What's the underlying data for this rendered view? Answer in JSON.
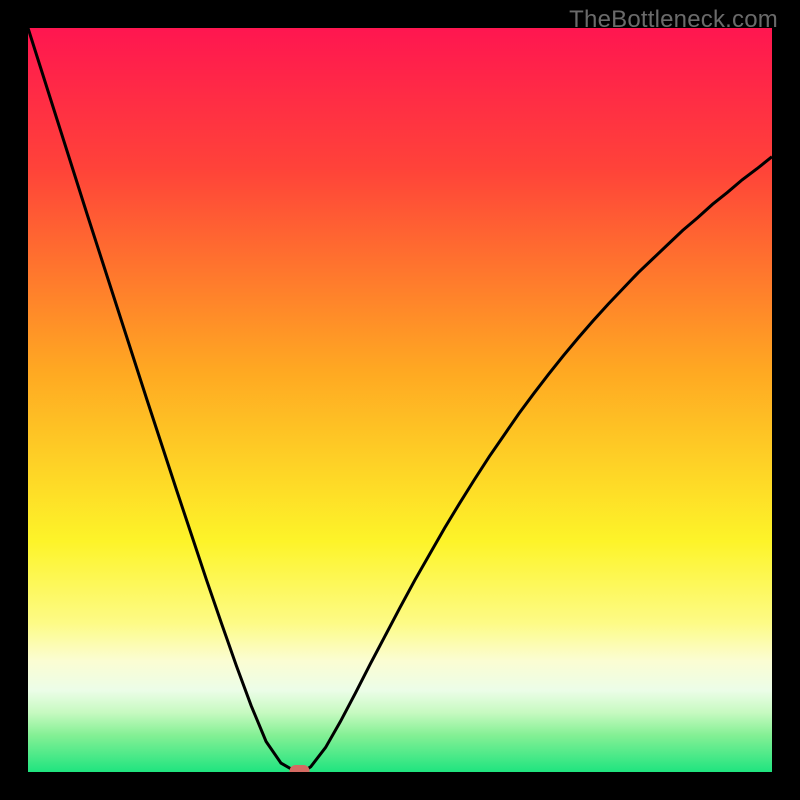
{
  "watermark": "TheBottleneck.com",
  "chart_data": {
    "type": "line",
    "title": "",
    "xlabel": "",
    "ylabel": "",
    "xlim": [
      0,
      100
    ],
    "ylim": [
      0,
      100
    ],
    "x": [
      0,
      2,
      4,
      6,
      8,
      10,
      12,
      14,
      16,
      18,
      20,
      22,
      24,
      26,
      28,
      30,
      32,
      34,
      36,
      36.5,
      37,
      38,
      40,
      42,
      44,
      46,
      48,
      50,
      52,
      54,
      56,
      58,
      60,
      62,
      64,
      66,
      68,
      70,
      72,
      74,
      76,
      78,
      80,
      82,
      84,
      86,
      88,
      90,
      92,
      94,
      96,
      98,
      100
    ],
    "y": [
      100,
      93.7,
      87.4,
      81.1,
      74.8,
      68.6,
      62.4,
      56.2,
      50.0,
      43.9,
      37.8,
      31.8,
      25.8,
      20.0,
      14.3,
      8.9,
      4.1,
      1.2,
      0.05,
      0,
      0.05,
      0.7,
      3.3,
      6.8,
      10.6,
      14.5,
      18.3,
      22.1,
      25.8,
      29.3,
      32.8,
      36.1,
      39.3,
      42.4,
      45.3,
      48.2,
      50.9,
      53.5,
      56.0,
      58.4,
      60.7,
      62.9,
      65.0,
      67.1,
      69.0,
      70.9,
      72.8,
      74.5,
      76.3,
      77.9,
      79.6,
      81.1,
      82.7
    ],
    "marker_position": {
      "x": 36.5,
      "y": 0
    },
    "gradient_stops": [
      {
        "pos": 0.0,
        "color": "#ff1650"
      },
      {
        "pos": 0.19,
        "color": "#ff4339"
      },
      {
        "pos": 0.46,
        "color": "#ffa822"
      },
      {
        "pos": 0.69,
        "color": "#fdf429"
      },
      {
        "pos": 0.8,
        "color": "#fdfb86"
      },
      {
        "pos": 0.85,
        "color": "#fbfdd2"
      },
      {
        "pos": 0.89,
        "color": "#ecfde8"
      },
      {
        "pos": 0.92,
        "color": "#c7fac1"
      },
      {
        "pos": 0.95,
        "color": "#85f095"
      },
      {
        "pos": 1.0,
        "color": "#1fe47f"
      }
    ],
    "marker_color": "#d56a62",
    "marker_w": 20,
    "marker_h": 14,
    "curve_color": "#000000",
    "curve_width": 3
  }
}
